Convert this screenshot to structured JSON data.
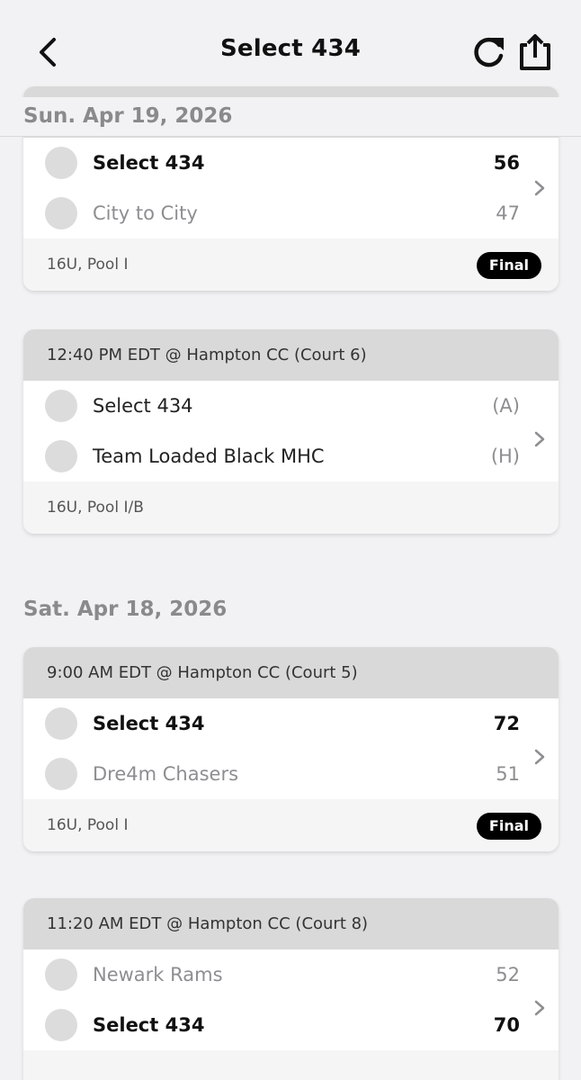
{
  "header": {
    "title": "Select 434",
    "back_icon": "chevron-left-icon",
    "refresh_icon": "refresh-icon",
    "share_icon": "share-icon"
  },
  "days": [
    {
      "date": "Sun. Apr 19, 2026",
      "games": [
        {
          "time_location": "",
          "teams": [
            {
              "name": "Select 434",
              "score": "56"
            },
            {
              "name": "City to City",
              "score": "47"
            }
          ],
          "division": "16U, Pool I",
          "status": "Final"
        },
        {
          "time_location": "12:40 PM EDT @ Hampton CC (Court 6)",
          "teams": [
            {
              "name": "Select 434",
              "score": "(A)"
            },
            {
              "name": "Team Loaded Black MHC",
              "score": "(H)"
            }
          ],
          "division": "16U, Pool I/B",
          "status": ""
        }
      ]
    },
    {
      "date": "Sat. Apr 18, 2026",
      "games": [
        {
          "time_location": "9:00 AM EDT @ Hampton CC (Court 5)",
          "teams": [
            {
              "name": "Select 434",
              "score": "72"
            },
            {
              "name": "Dre4m Chasers",
              "score": "51"
            }
          ],
          "division": "16U, Pool I",
          "status": "Final"
        },
        {
          "time_location": "11:20 AM EDT @ Hampton CC (Court 8)",
          "teams": [
            {
              "name": "Newark Rams",
              "score": "52"
            },
            {
              "name": "Select 434",
              "score": "70"
            }
          ],
          "division": "",
          "status": ""
        }
      ]
    }
  ]
}
